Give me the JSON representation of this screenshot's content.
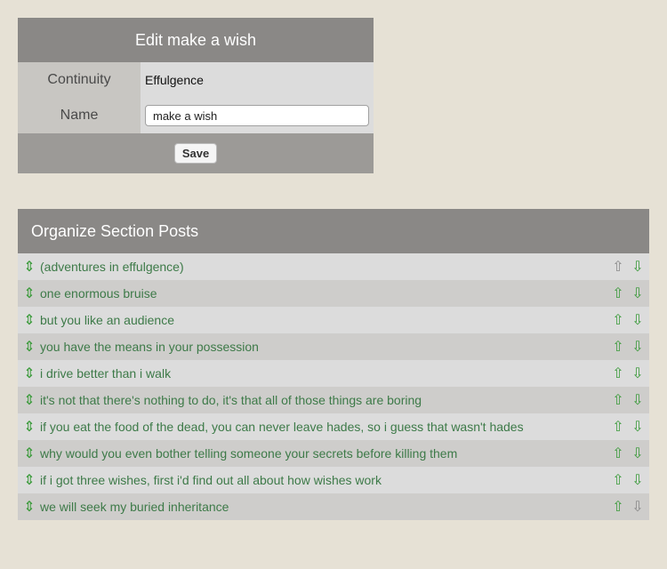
{
  "edit": {
    "title": "Edit make a wish",
    "continuity_label": "Continuity",
    "continuity_value": "Effulgence",
    "name_label": "Name",
    "name_value": "make a wish",
    "save_label": "Save"
  },
  "organize": {
    "title": "Organize Section Posts",
    "posts": [
      {
        "title": "(adventures in effulgence)",
        "up_enabled": false,
        "down_enabled": true
      },
      {
        "title": "one enormous bruise",
        "up_enabled": true,
        "down_enabled": true
      },
      {
        "title": "but you like an audience",
        "up_enabled": true,
        "down_enabled": true
      },
      {
        "title": "you have the means in your possession",
        "up_enabled": true,
        "down_enabled": true
      },
      {
        "title": "i drive better than i walk",
        "up_enabled": true,
        "down_enabled": true
      },
      {
        "title": "it's not that there's nothing to do, it's that all of those things are boring",
        "up_enabled": true,
        "down_enabled": true
      },
      {
        "title": "if you eat the food of the dead, you can never leave hades, so i guess that wasn't hades",
        "up_enabled": true,
        "down_enabled": true
      },
      {
        "title": "why would you even bother telling someone your secrets before killing them",
        "up_enabled": true,
        "down_enabled": true
      },
      {
        "title": "if i got three wishes, first i'd find out all about how wishes work",
        "up_enabled": true,
        "down_enabled": true
      },
      {
        "title": "we will seek my buried inheritance",
        "up_enabled": true,
        "down_enabled": false
      }
    ]
  },
  "icons": {
    "drag": "drag-handle-icon",
    "up": "arrow-up-icon",
    "down": "arrow-down-icon"
  },
  "colors": {
    "background": "#e6e1d5",
    "header": "#8a8886",
    "link_green": "#3d7a48",
    "arrow_green": "#3a9a3a",
    "disabled_gray": "#8a8a8a"
  }
}
